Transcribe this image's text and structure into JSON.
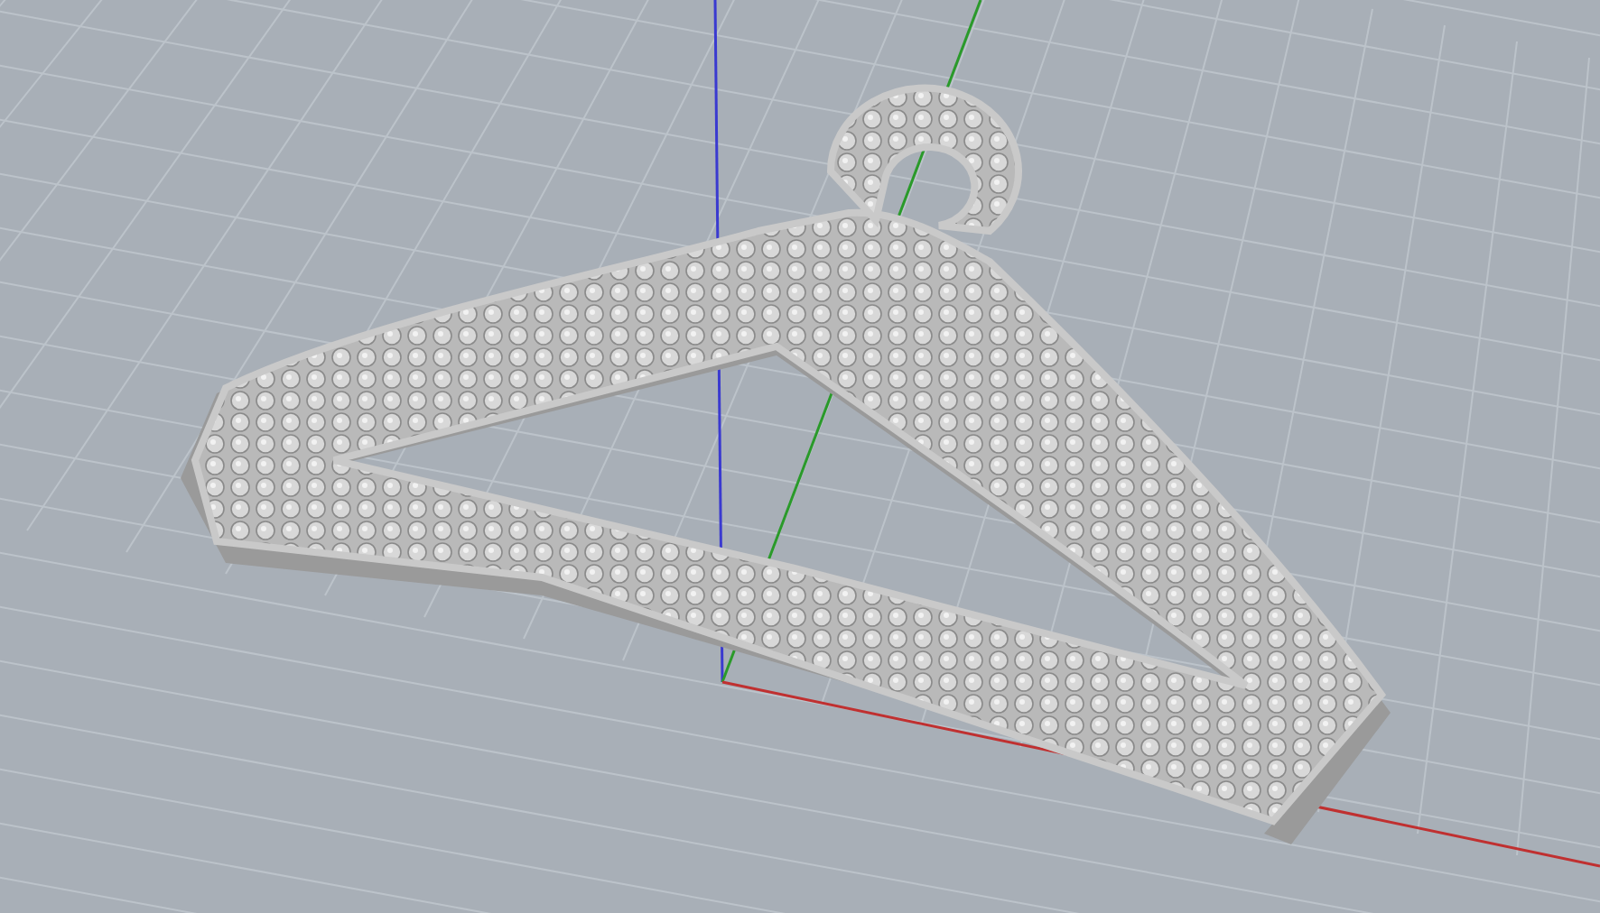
{
  "viewport": {
    "grid_shown": true,
    "axes_shown": true
  }
}
